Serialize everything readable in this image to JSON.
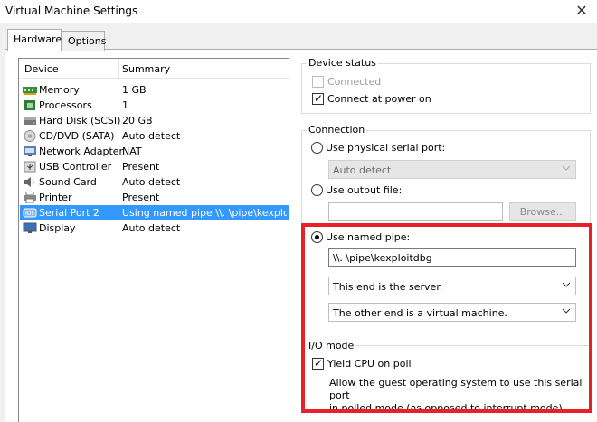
{
  "window": {
    "title": "Virtual Machine Settings"
  },
  "tabs": [
    {
      "label": "Hardware"
    },
    {
      "label": "Options"
    }
  ],
  "device_list": {
    "headers": {
      "device": "Device",
      "summary": "Summary"
    },
    "rows": [
      {
        "device": "Memory",
        "summary": "1 GB",
        "icon": "memory-icon"
      },
      {
        "device": "Processors",
        "summary": "1",
        "icon": "processor-icon"
      },
      {
        "device": "Hard Disk (SCSI)",
        "summary": "20 GB",
        "icon": "hard-disk-icon"
      },
      {
        "device": "CD/DVD (SATA)",
        "summary": "Auto detect",
        "icon": "cd-dvd-icon"
      },
      {
        "device": "Network Adapter",
        "summary": "NAT",
        "icon": "network-adapter-icon"
      },
      {
        "device": "USB Controller",
        "summary": "Present",
        "icon": "usb-icon"
      },
      {
        "device": "Sound Card",
        "summary": "Auto detect",
        "icon": "sound-card-icon"
      },
      {
        "device": "Printer",
        "summary": "Present",
        "icon": "printer-icon"
      },
      {
        "device": "Serial Port 2",
        "summary": "Using named pipe \\\\. \\pipe\\kexploit...",
        "icon": "serial-port-icon",
        "selected": true
      },
      {
        "device": "Display",
        "summary": "Auto detect",
        "icon": "display-icon"
      }
    ]
  },
  "device_status": {
    "title": "Device status",
    "connected": {
      "label": "Connected",
      "checked": false,
      "enabled": false
    },
    "connect_at_power_on": {
      "label": "Connect at power on",
      "checked": true
    }
  },
  "connection": {
    "title": "Connection",
    "physical_serial_port": {
      "label": "Use physical serial port:",
      "selected": false,
      "value": "Auto detect"
    },
    "output_file": {
      "label": "Use output file:",
      "selected": false,
      "value": "",
      "browse_label": "Browse..."
    },
    "named_pipe": {
      "label": "Use named pipe:",
      "selected": true,
      "value": "\\\\. \\pipe\\kexploitdbg",
      "this_end": "This end is the server.",
      "other_end": "The other end is a virtual machine."
    }
  },
  "io_mode": {
    "title": "I/O mode",
    "yield_cpu": {
      "label": "Yield CPU on poll",
      "checked": true
    },
    "description_line1": "Allow the guest operating system to use this serial port",
    "description_line2": "in polled mode (as opposed to interrupt mode)."
  },
  "colors": {
    "selection": "#3399ff",
    "highlight_border": "#e8202a"
  }
}
